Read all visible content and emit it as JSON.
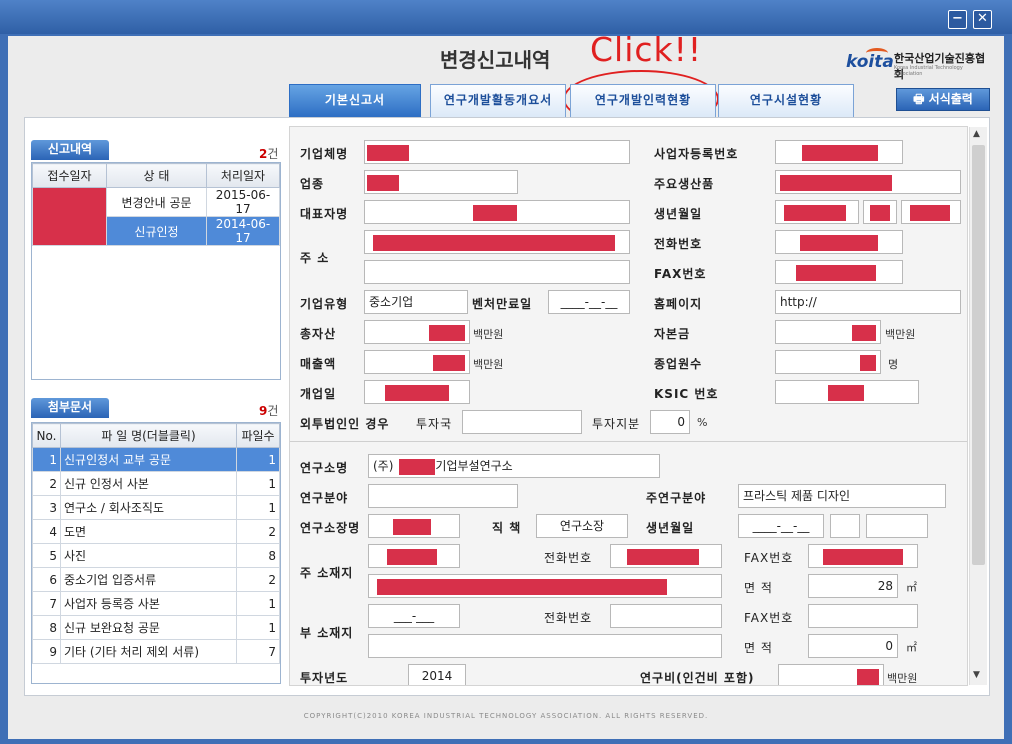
{
  "window": {
    "minimize": "−",
    "close": "✕"
  },
  "header": {
    "title": "변경신고내역",
    "annotation": "Click!!",
    "logo_mark": "koita",
    "logo_name": "한국산업기술진흥협회",
    "logo_sub": "Korea Industrial Technology Association"
  },
  "tabs": [
    "기본신고서",
    "연구개발활동개요서",
    "연구개발인력현황",
    "연구시설현황"
  ],
  "print_label": "서식출력",
  "reports": {
    "title": "신고내역",
    "count": "2",
    "count_unit": "건",
    "headers": [
      "접수일자",
      "상 태",
      "처리일자"
    ],
    "rows": [
      {
        "status": "변경안내 공문",
        "date": "2015-06-17"
      },
      {
        "status": "신규인정",
        "date": "2014-06-17"
      }
    ]
  },
  "attachments": {
    "title": "첨부문서",
    "count": "9",
    "count_unit": "건",
    "headers": [
      "No.",
      "파 일 명(더블클릭)",
      "파일수"
    ],
    "rows": [
      {
        "no": "1",
        "name": "신규인정서 교부 공문",
        "n": "1"
      },
      {
        "no": "2",
        "name": "신규 인정서 사본",
        "n": "1"
      },
      {
        "no": "3",
        "name": "연구소 / 회사조직도",
        "n": "1"
      },
      {
        "no": "4",
        "name": "도면",
        "n": "2"
      },
      {
        "no": "5",
        "name": "사진",
        "n": "8"
      },
      {
        "no": "6",
        "name": "중소기업 입증서류",
        "n": "2"
      },
      {
        "no": "7",
        "name": "사업자 등록증 사본",
        "n": "1"
      },
      {
        "no": "8",
        "name": "신규 보완요청 공문",
        "n": "1"
      },
      {
        "no": "9",
        "name": "기타 (기타 처리 제외 서류)",
        "n": "7"
      }
    ]
  },
  "company": {
    "labels": {
      "name": "기업체명",
      "biz_no": "사업자등록번호",
      "industry": "업종",
      "product": "주요생산품",
      "ceo": "대표자명",
      "birth": "생년월일",
      "address": "주 소",
      "phone": "전화번호",
      "fax": "FAX번호",
      "type": "기업유형",
      "venture": "벤처만료일",
      "homepage": "홈페이지",
      "assets": "총자산",
      "capital": "자본금",
      "sales": "매출액",
      "employees": "종업원수",
      "founded": "개업일",
      "ksic": "KSIC 번호",
      "foreign": "외투법인인 경우",
      "invest_country": "투자국",
      "invest_ratio": "투자지분"
    },
    "values": {
      "type": "중소기업",
      "venture": "____-__-__",
      "homepage": "http://",
      "invest_ratio": "0"
    },
    "units": {
      "million": "백만원",
      "people": "명",
      "percent": "%"
    }
  },
  "lab": {
    "labels": {
      "name": "연구소명",
      "field": "연구분야",
      "main_field": "주연구분야",
      "director": "연구소장명",
      "position": "직 책",
      "birth": "생년월일",
      "main_addr": "주 소재지",
      "phone": "전화번호",
      "fax": "FAX번호",
      "area": "면 적",
      "sub_addr": "부 소재지",
      "year": "투자년도",
      "budget": "연구비(인건비 포함)"
    },
    "values": {
      "name_prefix": "(주)",
      "name_suffix": "기업부설연구소",
      "main_field": "프라스틱 제품 디자인",
      "position": "연구소장",
      "birth": "____-__-__",
      "area_main": "28",
      "sub_phone": "___-___",
      "area_sub": "0",
      "year": "2014"
    },
    "units": {
      "sqm": "㎡",
      "million": "백만원"
    }
  },
  "footer": "COPYRIGHT(C)2010 KOREA INDUSTRIAL TECHNOLOGY ASSOCIATION. ALL RIGHTS RESERVED."
}
